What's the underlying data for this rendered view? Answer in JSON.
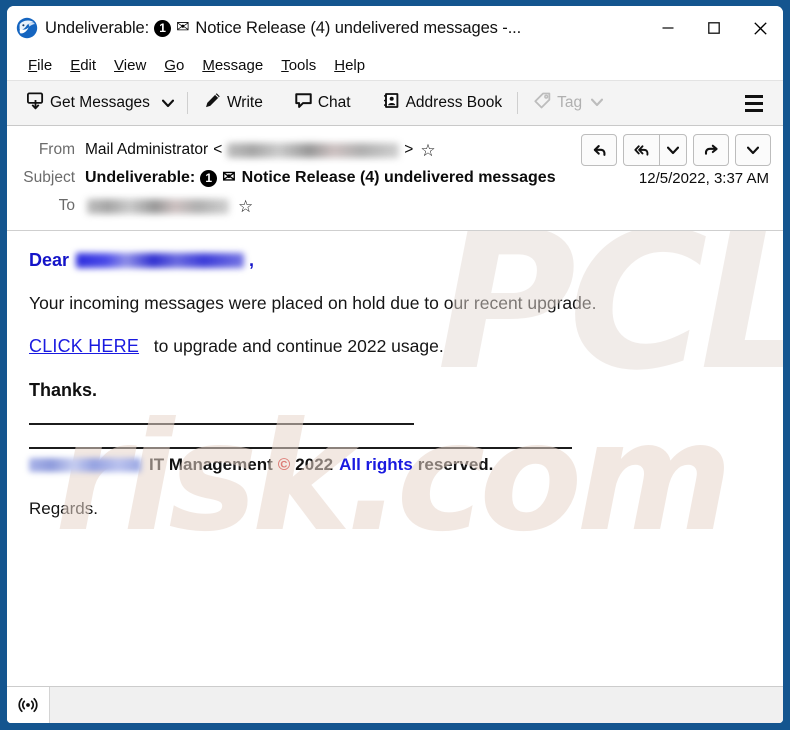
{
  "window": {
    "title_prefix": "Undeliverable:",
    "title_badge": "1",
    "title_rest": "Notice Release (4) undelivered messages -...",
    "app_icon": "thunderbird-icon",
    "controls": {
      "minimize": "—",
      "maximize": "□",
      "close": "✕"
    },
    "border_color": "#14558f"
  },
  "menubar": {
    "items": [
      {
        "pre": "",
        "key": "F",
        "post": "ile"
      },
      {
        "pre": "",
        "key": "E",
        "post": "dit"
      },
      {
        "pre": "",
        "key": "V",
        "post": "iew"
      },
      {
        "pre": "",
        "key": "G",
        "post": "o"
      },
      {
        "pre": "",
        "key": "M",
        "post": "essage"
      },
      {
        "pre": "",
        "key": "T",
        "post": "ools"
      },
      {
        "pre": "",
        "key": "H",
        "post": "elp"
      }
    ]
  },
  "toolbar": {
    "get_messages_label": "Get Messages",
    "write_label": "Write",
    "chat_label": "Chat",
    "address_book_label": "Address Book",
    "tag_label": "Tag",
    "tag_disabled": true,
    "app_menu": "hamburger-icon"
  },
  "message_header": {
    "from_label": "From",
    "from_name": "Mail Administrator",
    "from_bracket_open": "<",
    "from_bracket_close": ">",
    "from_address_redacted": true,
    "subject_label": "Subject",
    "subject_prefix": "Undeliverable:",
    "subject_badge": "1",
    "subject_rest": "Notice Release (4) undelivered messages",
    "date": "12/5/2022, 3:37 AM",
    "to_label": "To",
    "to_address_redacted": true,
    "actions": {
      "reply": "reply-icon",
      "reply_all": "reply-all-icon",
      "reply_all_more": "chevron-down-icon",
      "forward": "forward-icon",
      "more": "chevron-down-icon"
    }
  },
  "body": {
    "greeting_word": "Dear",
    "greeting_name_redacted": true,
    "greeting_comma": ",",
    "paragraph1": "Your incoming messages were placed on hold due to our recent upgrade.",
    "link_text": "CLICK HERE",
    "link_trailing": "to upgrade and continue 2022 usage.",
    "thanks": "Thanks.",
    "signature_company_redacted": true,
    "signature_text_1": "IT Management",
    "signature_copyright": "©",
    "signature_year": "2022",
    "signature_rights": "All rights",
    "signature_reserved": "reserved.",
    "regards": "Regards.",
    "watermark_top": "PCL",
    "watermark_bottom": "risk.com",
    "colors": {
      "link": "#1a1ae0",
      "greeting": "#1414c8",
      "copyright": "#d01010",
      "rights": "#1a1ae0"
    }
  },
  "statusbar": {
    "icon": "broadcast-icon",
    "progress_text": ""
  }
}
